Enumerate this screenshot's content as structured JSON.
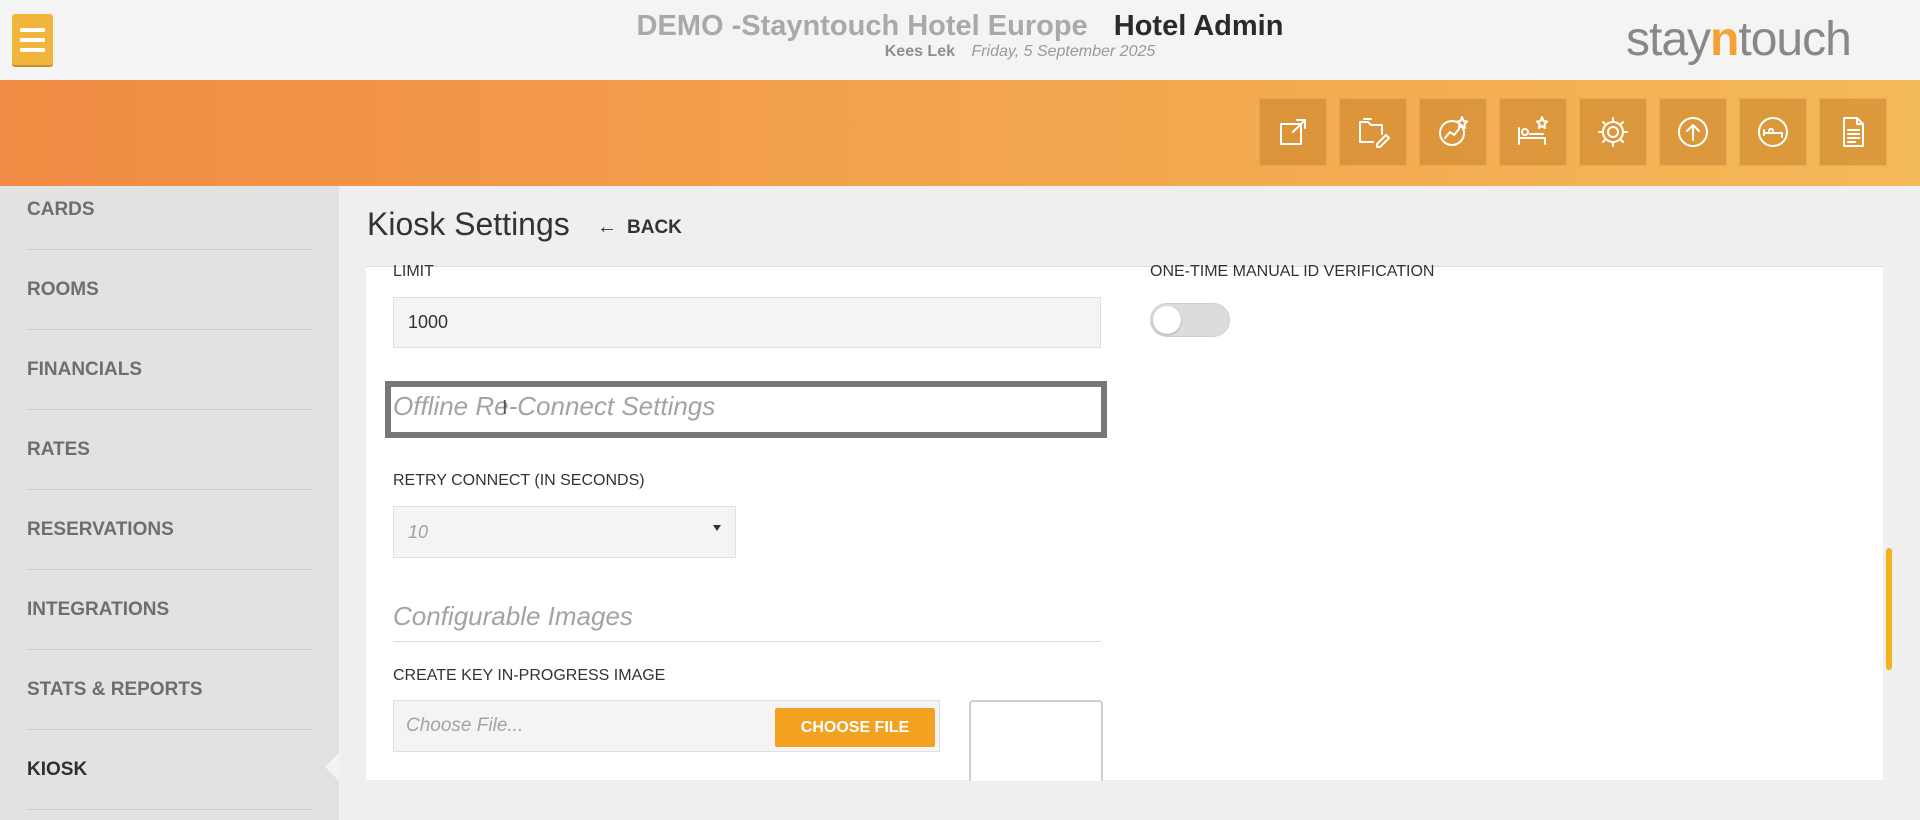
{
  "header": {
    "hotel_name": "DEMO -Stayntouch Hotel Europe",
    "admin_title": "Hotel Admin",
    "user_name": "Kees Lek",
    "date": "Friday, 5 September 2025",
    "logo_prefix": "stay",
    "logo_accent": "n",
    "logo_suffix": "touch",
    "menu_icon": "hamburger-icon",
    "colors": {
      "menu_button": "#f1b53b",
      "band_start": "#f18b45",
      "band_end": "#f4b957",
      "logo_accent": "#f3a233"
    }
  },
  "toolbar": {
    "icons": [
      "external-link-icon",
      "folder-edit-icon",
      "chart-star-icon",
      "bed-star-icon",
      "gear-icon",
      "upload-circle-icon",
      "sleep-circle-icon",
      "document-icon"
    ]
  },
  "sidebar": {
    "items": [
      {
        "label": "CARDS"
      },
      {
        "label": "ROOMS"
      },
      {
        "label": "FINANCIALS"
      },
      {
        "label": "RATES"
      },
      {
        "label": "RESERVATIONS"
      },
      {
        "label": "INTEGRATIONS"
      },
      {
        "label": "STATS & REPORTS"
      },
      {
        "label": "KIOSK"
      }
    ],
    "active": "KIOSK"
  },
  "main": {
    "title": "Kiosk Settings",
    "back_label": "BACK",
    "limit_label": "LIMIT",
    "limit_value": "1000",
    "manual_id_label": "ONE-TIME MANUAL ID VERIFICATION",
    "manual_id_enabled": false,
    "offline_section_title": "Offline Re-Connect Settings",
    "retry_label": "RETRY CONNECT (IN SECONDS)",
    "retry_value": "10",
    "images_section_title": "Configurable Images",
    "key_image_label": "CREATE KEY IN-PROGRESS IMAGE",
    "file_placeholder": "Choose File...",
    "choose_file_label": "CHOOSE FILE",
    "accent_color": "#f2a220"
  }
}
